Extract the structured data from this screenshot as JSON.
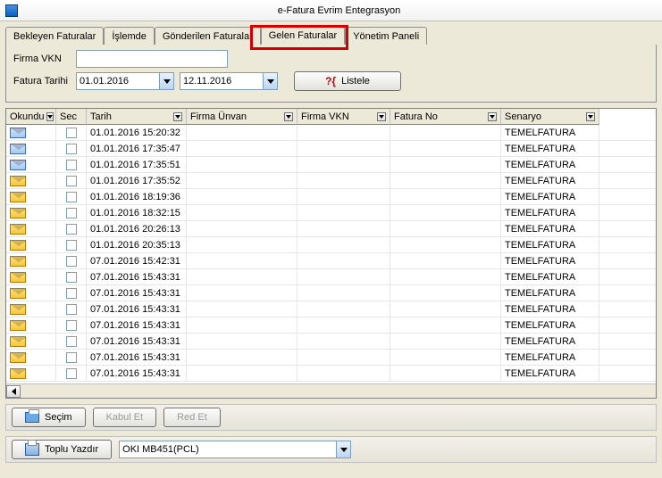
{
  "window": {
    "title": "e-Fatura Evrim Entegrasyon"
  },
  "tabs": {
    "bekleyen": "Bekleyen Faturalar",
    "islemde": "İşlemde",
    "gonderilen": "Gönderilen Faturalar",
    "gelen": "Gelen Faturalar",
    "yonetim": "Yönetim Paneli"
  },
  "filter": {
    "firma_vkn_label": "Firma VKN",
    "firma_vkn_value": "",
    "fatura_tarihi_label": "Fatura Tarihi",
    "date_from": "01.01.2016",
    "date_to": "12.11.2016",
    "listele_label": "Listele"
  },
  "grid": {
    "headers": {
      "okundu": "Okundu",
      "sec": "Sec",
      "tarih": "Tarih",
      "unvan": "Firma Ünvan",
      "vkn": "Firma VKN",
      "fatno": "Fatura No",
      "senaryo": "Senaryo"
    },
    "rows": [
      {
        "read": true,
        "tarih": "01.01.2016 15:20:32",
        "senaryo": "TEMELFATURA"
      },
      {
        "read": true,
        "tarih": "01.01.2016 17:35:47",
        "senaryo": "TEMELFATURA"
      },
      {
        "read": true,
        "tarih": "01.01.2016 17:35:51",
        "senaryo": "TEMELFATURA"
      },
      {
        "read": false,
        "tarih": "01.01.2016 17:35:52",
        "senaryo": "TEMELFATURA"
      },
      {
        "read": false,
        "tarih": "01.01.2016 18:19:36",
        "senaryo": "TEMELFATURA"
      },
      {
        "read": false,
        "tarih": "01.01.2016 18:32:15",
        "senaryo": "TEMELFATURA"
      },
      {
        "read": false,
        "tarih": "01.01.2016 20:26:13",
        "senaryo": "TEMELFATURA"
      },
      {
        "read": false,
        "tarih": "01.01.2016 20:35:13",
        "senaryo": "TEMELFATURA"
      },
      {
        "read": false,
        "tarih": "07.01.2016 15:42:31",
        "senaryo": "TEMELFATURA"
      },
      {
        "read": false,
        "tarih": "07.01.2016 15:43:31",
        "senaryo": "TEMELFATURA"
      },
      {
        "read": false,
        "tarih": "07.01.2016 15:43:31",
        "senaryo": "TEMELFATURA"
      },
      {
        "read": false,
        "tarih": "07.01.2016 15:43:31",
        "senaryo": "TEMELFATURA"
      },
      {
        "read": false,
        "tarih": "07.01.2016 15:43:31",
        "senaryo": "TEMELFATURA"
      },
      {
        "read": false,
        "tarih": "07.01.2016 15:43:31",
        "senaryo": "TEMELFATURA"
      },
      {
        "read": false,
        "tarih": "07.01.2016 15:43:31",
        "senaryo": "TEMELFATURA"
      },
      {
        "read": false,
        "tarih": "07.01.2016 15:43:31",
        "senaryo": "TEMELFATURA"
      }
    ]
  },
  "footer": {
    "secim": "Seçim",
    "kabul": "Kabul Et",
    "red": "Red Et",
    "toplu_yazdir": "Toplu Yazdır",
    "printer": "OKI MB451(PCL)"
  }
}
